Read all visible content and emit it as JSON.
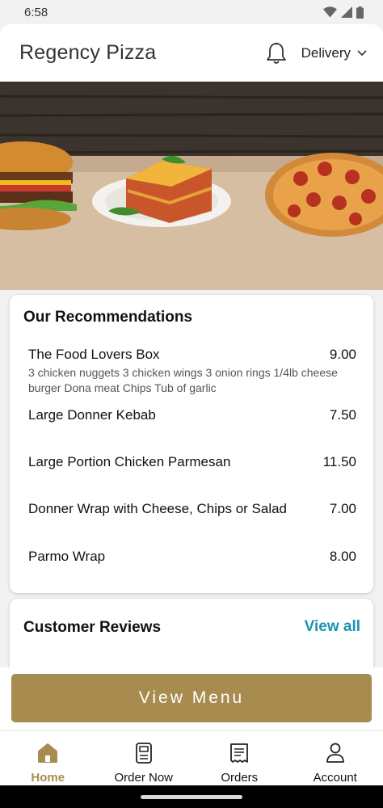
{
  "status_bar": {
    "time": "6:58"
  },
  "header": {
    "title": "Regency Pizza",
    "delivery_mode": "Delivery"
  },
  "recommendations": {
    "title": "Our Recommendations",
    "items": [
      {
        "name": "The Food Lovers Box",
        "price": "9.00",
        "description": "3 chicken nuggets 3 chicken wings 3 onion rings 1/4lb cheese burger Dona meat Chips Tub of garlic"
      },
      {
        "name": "Large Donner Kebab",
        "price": "7.50"
      },
      {
        "name": "Large Portion Chicken Parmesan",
        "price": "11.50"
      },
      {
        "name": "Donner Wrap with Cheese, Chips or Salad",
        "price": "7.00"
      },
      {
        "name": "Parmo Wrap",
        "price": "8.00"
      }
    ]
  },
  "reviews": {
    "title": "Customer Reviews",
    "view_all": "View all"
  },
  "view_menu_label": "View Menu",
  "bottom_nav": [
    {
      "label": "Home",
      "icon": "home-icon",
      "active": true
    },
    {
      "label": "Order Now",
      "icon": "order-now-icon",
      "active": false
    },
    {
      "label": "Orders",
      "icon": "receipt-icon",
      "active": false
    },
    {
      "label": "Account",
      "icon": "account-icon",
      "active": false
    }
  ],
  "colors": {
    "accent": "#a88c4f",
    "link": "#1b93b3"
  }
}
